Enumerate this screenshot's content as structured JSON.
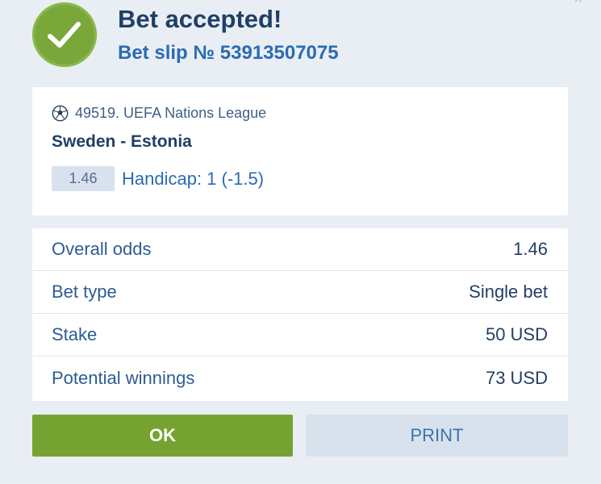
{
  "header": {
    "title": "Bet accepted!",
    "slip_number": "Bet slip № 53913507075",
    "success_icon": "checkmark-icon"
  },
  "event": {
    "sport_icon": "soccer-ball-icon",
    "league": "49519. UEFA Nations League",
    "match": "Sweden - Estonia",
    "odds": "1.46",
    "market": "Handicap: 1 (-1.5)"
  },
  "summary": {
    "rows": [
      {
        "label": "Overall odds",
        "value": "1.46"
      },
      {
        "label": "Bet type",
        "value": "Single bet"
      },
      {
        "label": "Stake",
        "value": "50 USD"
      },
      {
        "label": "Potential winnings",
        "value": "73 USD"
      }
    ]
  },
  "actions": {
    "ok_label": "OK",
    "print_label": "PRINT"
  },
  "colors": {
    "success": "#7aa73a",
    "primary_text": "#1f3f66",
    "link_blue": "#2b6cb0",
    "background": "#e9eef4",
    "secondary_button": "#d8e2ed"
  }
}
